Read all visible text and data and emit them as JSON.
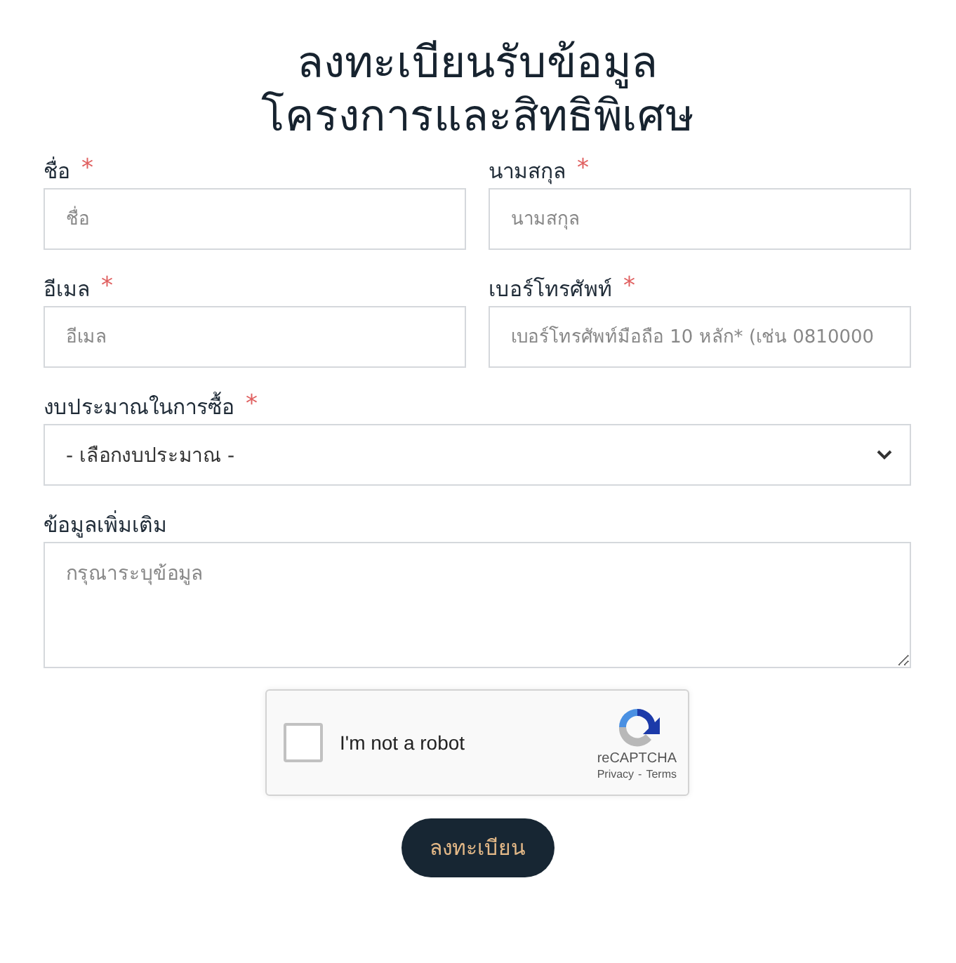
{
  "title": [
    "ลงทะเบียนรับข้อมูล",
    "โครงการและสิทธิพิเศษ"
  ],
  "rows": [
    {
      "fields": [
        {
          "kind": "text",
          "label": "ชื่อ",
          "mark": "*",
          "placeholder": "ชื่อ"
        },
        {
          "kind": "text",
          "label": "นามสกุล",
          "mark": "*",
          "placeholder": "นามสกุล"
        }
      ]
    },
    {
      "fields": [
        {
          "kind": "text",
          "label": "อีเมล",
          "mark": "*",
          "placeholder": "อีเมล"
        },
        {
          "kind": "text",
          "label": "เบอร์โทรศัพท์",
          "mark": "*",
          "placeholder": "เบอร์โทรศัพท์มือถือ 10 หลัก* (เช่น 0810000"
        }
      ]
    },
    {
      "fields": [
        {
          "kind": "select",
          "label": "งบประมาณในการซื้อ",
          "mark": "*",
          "value": "- เลือกงบประมาณ -"
        }
      ]
    },
    {
      "fields": [
        {
          "kind": "textarea",
          "label": "ข้อมูลเพิ่มเติม",
          "placeholder": "กรุณาระบุข้อมูล"
        }
      ]
    }
  ],
  "captcha": {
    "checked": false,
    "label": "I'm not a robot",
    "brand": "reCAPTCHA",
    "privacy": "Privacy",
    "separator": "-",
    "terms": "Terms"
  },
  "submit": "ลงทะเบียน"
}
